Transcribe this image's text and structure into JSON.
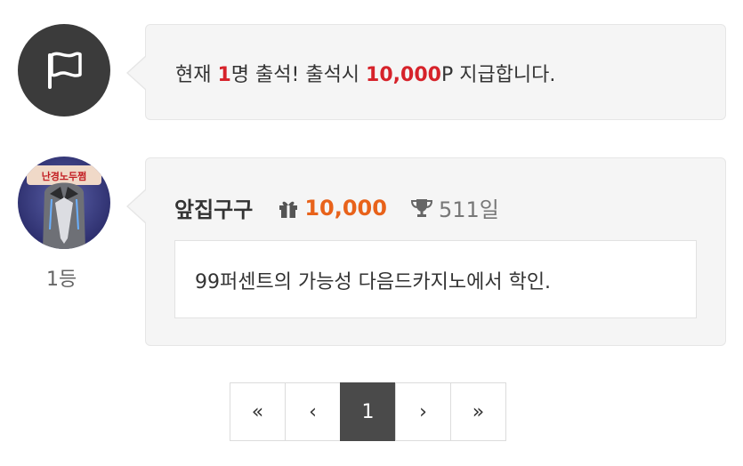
{
  "notice": {
    "prefix": "현재 ",
    "count": "1",
    "middle": "명 출석! 출석시 ",
    "points": "10,000",
    "suffix": "P 지급합니다."
  },
  "entry": {
    "rank": "1등",
    "avatar_text": "난경노두쩜",
    "username": "앞집구구",
    "points": "10,000",
    "days": "511일",
    "message": "99퍼센트의 가능성 다음드카지노에서 학인."
  },
  "pagination": {
    "first": "«",
    "prev": "‹",
    "current": "1",
    "next": "›",
    "last": "»"
  },
  "colors": {
    "accent_red": "#d6222a",
    "accent_orange": "#e8621a",
    "dark": "#3b3b3b"
  },
  "icons": [
    "flag-icon",
    "gift-icon",
    "trophy-icon"
  ]
}
